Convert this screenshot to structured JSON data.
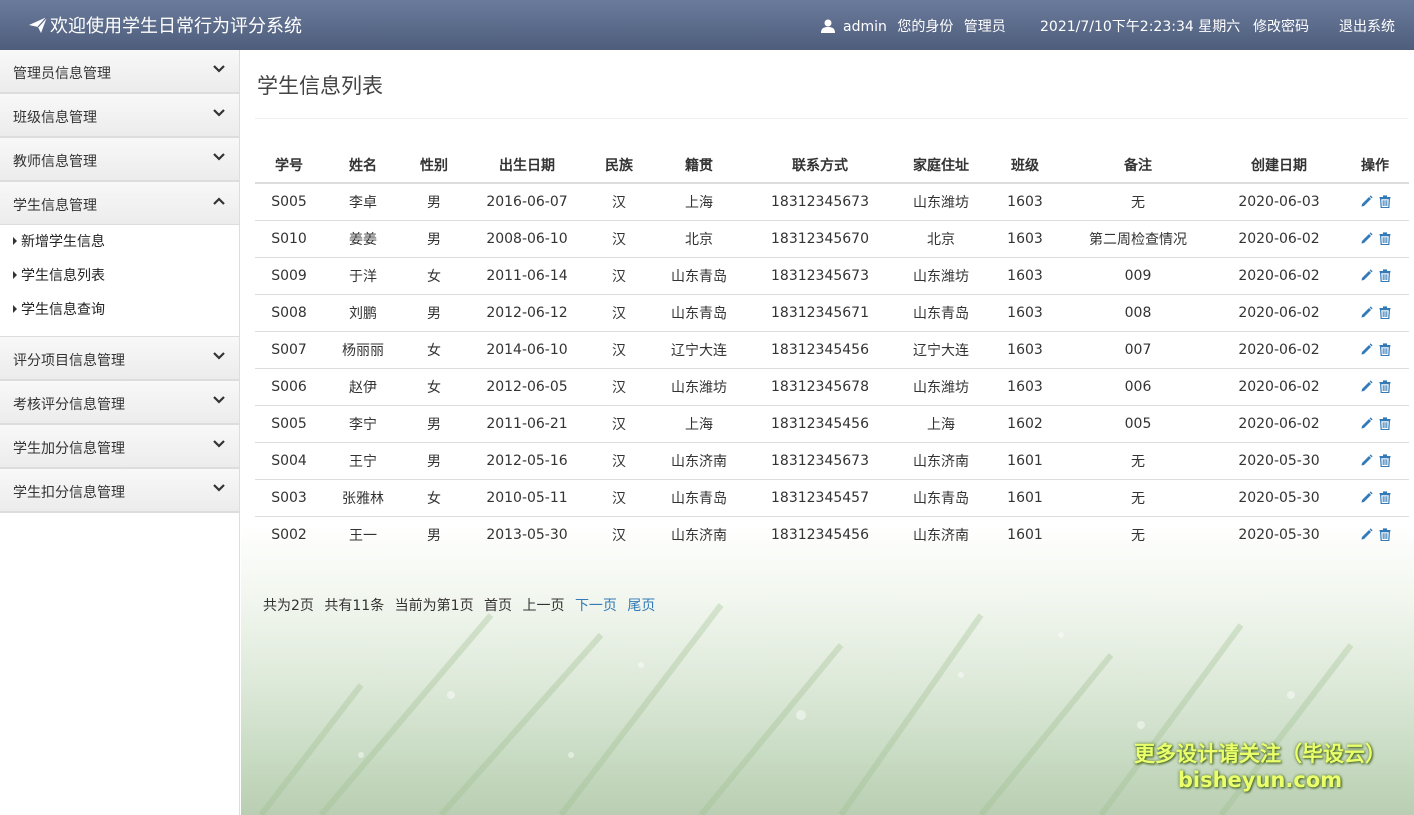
{
  "header": {
    "title": "欢迎使用学生日常行为评分系统",
    "username": "admin",
    "role_label": "您的身份",
    "role": "管理员",
    "datetime": "2021/7/10下午2:23:34 星期六",
    "change_password": "修改密码",
    "logout": "退出系统"
  },
  "sidebar": {
    "menus": [
      {
        "label": "管理员信息管理"
      },
      {
        "label": "班级信息管理"
      },
      {
        "label": "教师信息管理"
      },
      {
        "label": "学生信息管理"
      },
      {
        "label": "评分项目信息管理"
      },
      {
        "label": "考核评分信息管理"
      },
      {
        "label": "学生加分信息管理"
      },
      {
        "label": "学生扣分信息管理"
      }
    ],
    "submenu": [
      "新增学生信息",
      "学生信息列表",
      "学生信息查询"
    ]
  },
  "main": {
    "title": "学生信息列表",
    "columns": [
      "学号",
      "姓名",
      "性别",
      "出生日期",
      "民族",
      "籍贯",
      "联系方式",
      "家庭住址",
      "班级",
      "备注",
      "创建日期",
      "操作"
    ],
    "rows": [
      [
        "S005",
        "李卓",
        "男",
        "2016-06-07",
        "汉",
        "上海",
        "18312345673",
        "山东潍坊",
        "1603",
        "无",
        "2020-06-03"
      ],
      [
        "S010",
        "姜姜",
        "男",
        "2008-06-10",
        "汉",
        "北京",
        "18312345670",
        "北京",
        "1603",
        "第二周检查情况",
        "2020-06-02"
      ],
      [
        "S009",
        "于洋",
        "女",
        "2011-06-14",
        "汉",
        "山东青岛",
        "18312345673",
        "山东潍坊",
        "1603",
        "009",
        "2020-06-02"
      ],
      [
        "S008",
        "刘鹏",
        "男",
        "2012-06-12",
        "汉",
        "山东青岛",
        "18312345671",
        "山东青岛",
        "1603",
        "008",
        "2020-06-02"
      ],
      [
        "S007",
        "杨丽丽",
        "女",
        "2014-06-10",
        "汉",
        "辽宁大连",
        "18312345456",
        "辽宁大连",
        "1603",
        "007",
        "2020-06-02"
      ],
      [
        "S006",
        "赵伊",
        "女",
        "2012-06-05",
        "汉",
        "山东潍坊",
        "18312345678",
        "山东潍坊",
        "1603",
        "006",
        "2020-06-02"
      ],
      [
        "S005",
        "李宁",
        "男",
        "2011-06-21",
        "汉",
        "上海",
        "18312345456",
        "上海",
        "1602",
        "005",
        "2020-06-02"
      ],
      [
        "S004",
        "王宁",
        "男",
        "2012-05-16",
        "汉",
        "山东济南",
        "18312345673",
        "山东济南",
        "1601",
        "无",
        "2020-05-30"
      ],
      [
        "S003",
        "张雅林",
        "女",
        "2010-05-11",
        "汉",
        "山东青岛",
        "18312345457",
        "山东青岛",
        "1601",
        "无",
        "2020-05-30"
      ],
      [
        "S002",
        "王一",
        "男",
        "2013-05-30",
        "汉",
        "山东济南",
        "18312345456",
        "山东济南",
        "1601",
        "无",
        "2020-05-30"
      ]
    ],
    "row_action_icons": [
      "pencil-icon",
      "trash-icon"
    ]
  },
  "pager": {
    "total_pages": "共为2页",
    "total_items": "共有11条",
    "current": "当前为第1页",
    "first": "首页",
    "prev": "上一页",
    "next": "下一页",
    "last": "尾页"
  },
  "watermark": {
    "line1": "更多设计请关注（毕设云）",
    "line2": "bisheyun.com"
  },
  "colors": {
    "header_bg": "#56658a",
    "link": "#337ab7",
    "icon": "#337ab7",
    "watermark": "#eaff6b"
  }
}
